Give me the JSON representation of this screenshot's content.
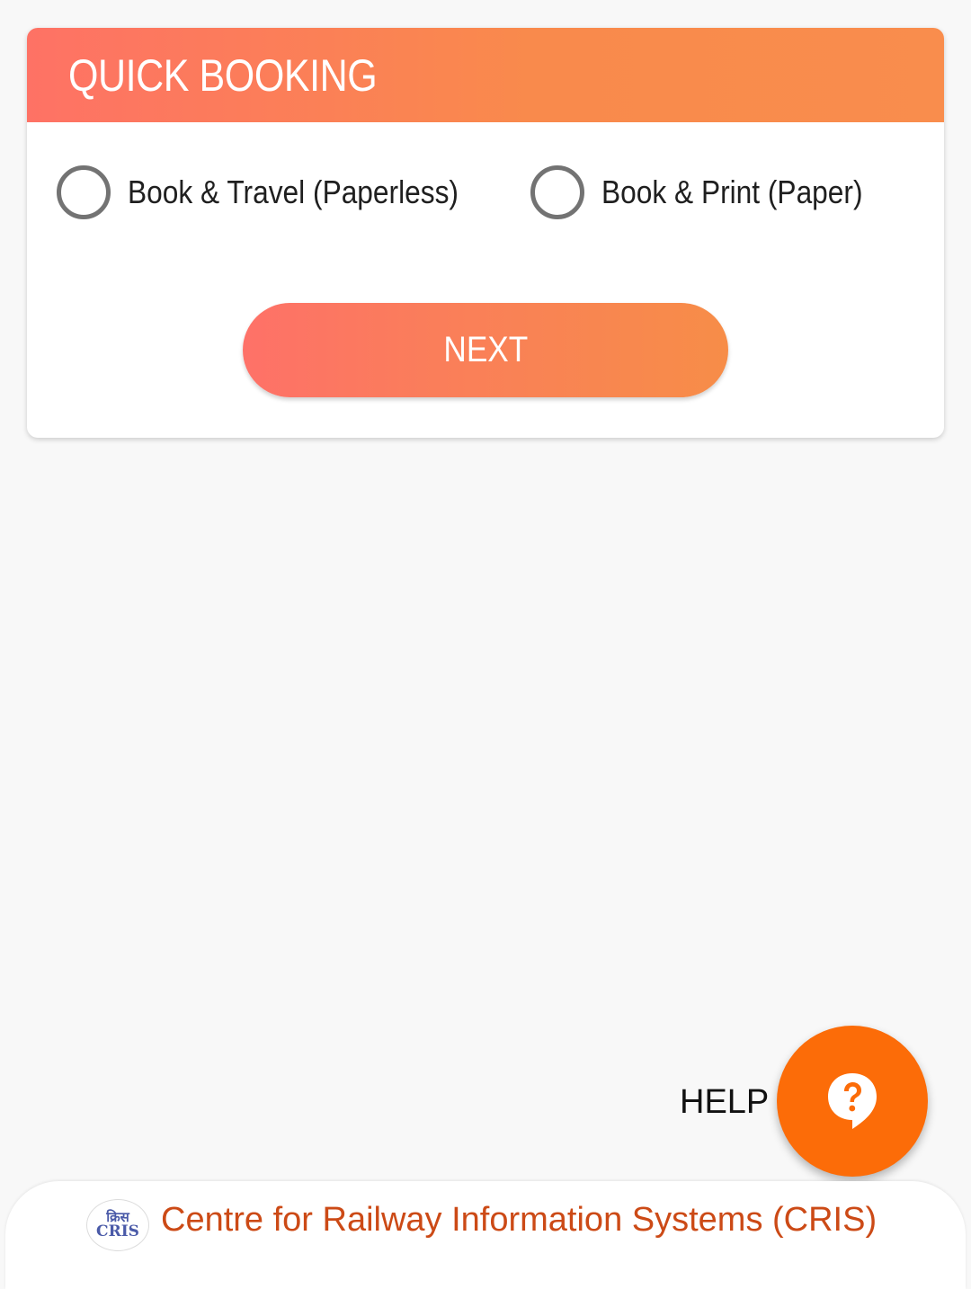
{
  "quick_booking": {
    "title": "QUICK BOOKING",
    "options": [
      {
        "label": "Book & Travel (Paperless)",
        "selected": false
      },
      {
        "label": "Book & Print (Paper)",
        "selected": false
      }
    ],
    "next_label": "NEXT"
  },
  "help": {
    "label": "HELP",
    "icon": "help-chat-icon"
  },
  "footer": {
    "logo_text_hindi": "क्रिस",
    "logo_text": "CRIS",
    "org_name": "Centre for Railway Information Systems (CRIS)"
  },
  "colors": {
    "header_gradient_start": "#fe7265",
    "header_gradient_end": "#f98d4d",
    "fab": "#fc6c08",
    "footer_text": "#cc4a16",
    "radio_border": "#737373"
  }
}
